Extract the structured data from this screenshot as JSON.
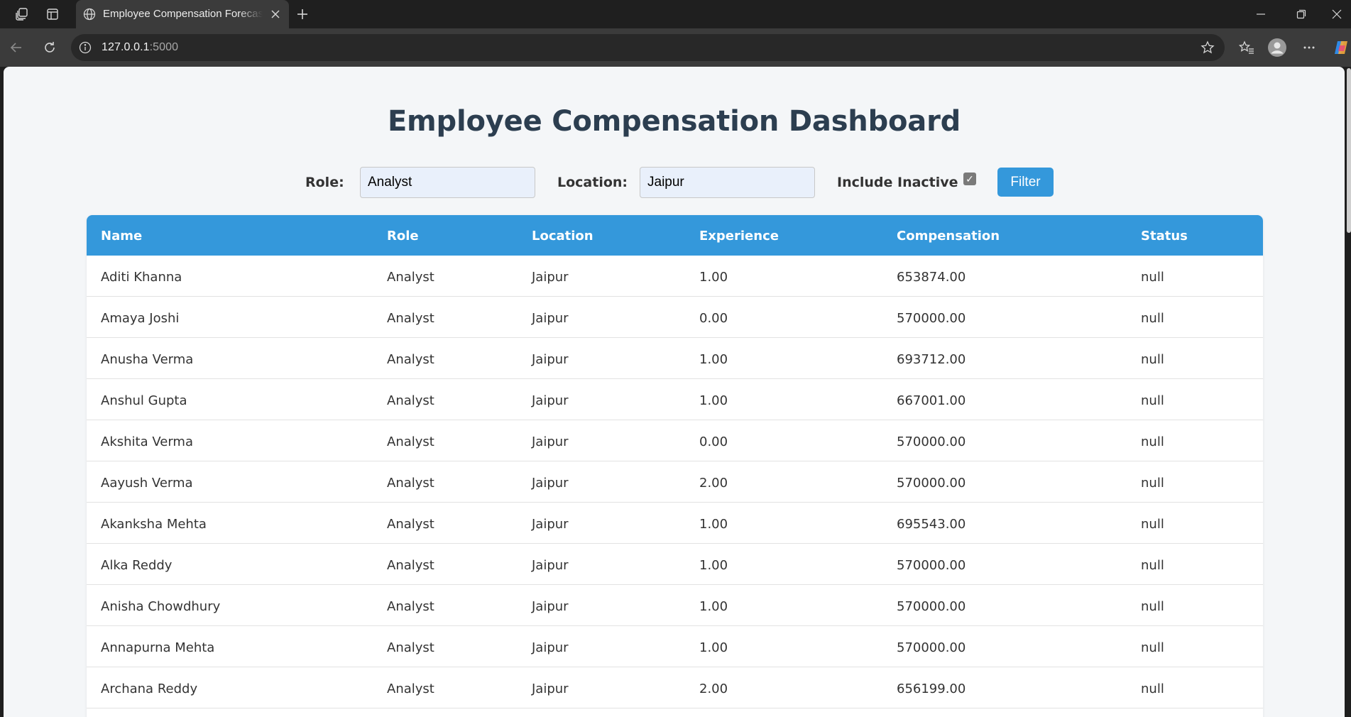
{
  "browser": {
    "tab_title": "Employee Compensation Forecast",
    "url_host": "127.0.0.1",
    "url_port": ":5000"
  },
  "page": {
    "title": "Employee Compensation Dashboard"
  },
  "filters": {
    "role_label": "Role:",
    "role_value": "Analyst",
    "location_label": "Location:",
    "location_value": "Jaipur",
    "inactive_label": "Include Inactive",
    "inactive_checked": true,
    "button_label": "Filter"
  },
  "table": {
    "columns": [
      "Name",
      "Role",
      "Location",
      "Experience",
      "Compensation",
      "Status"
    ],
    "rows": [
      [
        "Aditi Khanna",
        "Analyst",
        "Jaipur",
        "1.00",
        "653874.00",
        "null"
      ],
      [
        "Amaya Joshi",
        "Analyst",
        "Jaipur",
        "0.00",
        "570000.00",
        "null"
      ],
      [
        "Anusha Verma",
        "Analyst",
        "Jaipur",
        "1.00",
        "693712.00",
        "null"
      ],
      [
        "Anshul Gupta",
        "Analyst",
        "Jaipur",
        "1.00",
        "667001.00",
        "null"
      ],
      [
        "Akshita Verma",
        "Analyst",
        "Jaipur",
        "0.00",
        "570000.00",
        "null"
      ],
      [
        "Aayush Verma",
        "Analyst",
        "Jaipur",
        "2.00",
        "570000.00",
        "null"
      ],
      [
        "Akanksha Mehta",
        "Analyst",
        "Jaipur",
        "1.00",
        "695543.00",
        "null"
      ],
      [
        "Alka Reddy",
        "Analyst",
        "Jaipur",
        "1.00",
        "570000.00",
        "null"
      ],
      [
        "Anisha Chowdhury",
        "Analyst",
        "Jaipur",
        "1.00",
        "570000.00",
        "null"
      ],
      [
        "Annapurna Mehta",
        "Analyst",
        "Jaipur",
        "1.00",
        "570000.00",
        "null"
      ],
      [
        "Archana Reddy",
        "Analyst",
        "Jaipur",
        "2.00",
        "656199.00",
        "null"
      ]
    ]
  },
  "colors": {
    "accent": "#3498db",
    "title": "#2c3e50",
    "page_bg": "#f4f6f8"
  }
}
